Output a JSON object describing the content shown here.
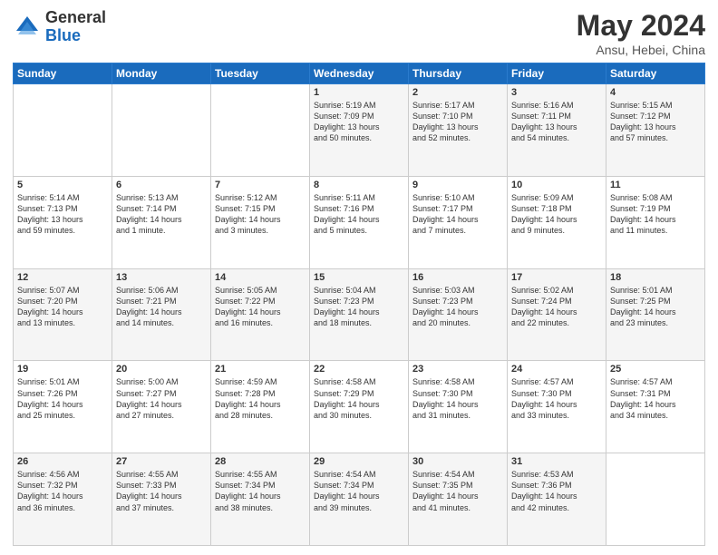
{
  "logo": {
    "general": "General",
    "blue": "Blue"
  },
  "title": {
    "month": "May 2024",
    "location": "Ansu, Hebei, China"
  },
  "weekdays": [
    "Sunday",
    "Monday",
    "Tuesday",
    "Wednesday",
    "Thursday",
    "Friday",
    "Saturday"
  ],
  "weeks": [
    [
      {
        "day": "",
        "info": ""
      },
      {
        "day": "",
        "info": ""
      },
      {
        "day": "",
        "info": ""
      },
      {
        "day": "1",
        "info": "Sunrise: 5:19 AM\nSunset: 7:09 PM\nDaylight: 13 hours\nand 50 minutes."
      },
      {
        "day": "2",
        "info": "Sunrise: 5:17 AM\nSunset: 7:10 PM\nDaylight: 13 hours\nand 52 minutes."
      },
      {
        "day": "3",
        "info": "Sunrise: 5:16 AM\nSunset: 7:11 PM\nDaylight: 13 hours\nand 54 minutes."
      },
      {
        "day": "4",
        "info": "Sunrise: 5:15 AM\nSunset: 7:12 PM\nDaylight: 13 hours\nand 57 minutes."
      }
    ],
    [
      {
        "day": "5",
        "info": "Sunrise: 5:14 AM\nSunset: 7:13 PM\nDaylight: 13 hours\nand 59 minutes."
      },
      {
        "day": "6",
        "info": "Sunrise: 5:13 AM\nSunset: 7:14 PM\nDaylight: 14 hours\nand 1 minute."
      },
      {
        "day": "7",
        "info": "Sunrise: 5:12 AM\nSunset: 7:15 PM\nDaylight: 14 hours\nand 3 minutes."
      },
      {
        "day": "8",
        "info": "Sunrise: 5:11 AM\nSunset: 7:16 PM\nDaylight: 14 hours\nand 5 minutes."
      },
      {
        "day": "9",
        "info": "Sunrise: 5:10 AM\nSunset: 7:17 PM\nDaylight: 14 hours\nand 7 minutes."
      },
      {
        "day": "10",
        "info": "Sunrise: 5:09 AM\nSunset: 7:18 PM\nDaylight: 14 hours\nand 9 minutes."
      },
      {
        "day": "11",
        "info": "Sunrise: 5:08 AM\nSunset: 7:19 PM\nDaylight: 14 hours\nand 11 minutes."
      }
    ],
    [
      {
        "day": "12",
        "info": "Sunrise: 5:07 AM\nSunset: 7:20 PM\nDaylight: 14 hours\nand 13 minutes."
      },
      {
        "day": "13",
        "info": "Sunrise: 5:06 AM\nSunset: 7:21 PM\nDaylight: 14 hours\nand 14 minutes."
      },
      {
        "day": "14",
        "info": "Sunrise: 5:05 AM\nSunset: 7:22 PM\nDaylight: 14 hours\nand 16 minutes."
      },
      {
        "day": "15",
        "info": "Sunrise: 5:04 AM\nSunset: 7:23 PM\nDaylight: 14 hours\nand 18 minutes."
      },
      {
        "day": "16",
        "info": "Sunrise: 5:03 AM\nSunset: 7:23 PM\nDaylight: 14 hours\nand 20 minutes."
      },
      {
        "day": "17",
        "info": "Sunrise: 5:02 AM\nSunset: 7:24 PM\nDaylight: 14 hours\nand 22 minutes."
      },
      {
        "day": "18",
        "info": "Sunrise: 5:01 AM\nSunset: 7:25 PM\nDaylight: 14 hours\nand 23 minutes."
      }
    ],
    [
      {
        "day": "19",
        "info": "Sunrise: 5:01 AM\nSunset: 7:26 PM\nDaylight: 14 hours\nand 25 minutes."
      },
      {
        "day": "20",
        "info": "Sunrise: 5:00 AM\nSunset: 7:27 PM\nDaylight: 14 hours\nand 27 minutes."
      },
      {
        "day": "21",
        "info": "Sunrise: 4:59 AM\nSunset: 7:28 PM\nDaylight: 14 hours\nand 28 minutes."
      },
      {
        "day": "22",
        "info": "Sunrise: 4:58 AM\nSunset: 7:29 PM\nDaylight: 14 hours\nand 30 minutes."
      },
      {
        "day": "23",
        "info": "Sunrise: 4:58 AM\nSunset: 7:30 PM\nDaylight: 14 hours\nand 31 minutes."
      },
      {
        "day": "24",
        "info": "Sunrise: 4:57 AM\nSunset: 7:30 PM\nDaylight: 14 hours\nand 33 minutes."
      },
      {
        "day": "25",
        "info": "Sunrise: 4:57 AM\nSunset: 7:31 PM\nDaylight: 14 hours\nand 34 minutes."
      }
    ],
    [
      {
        "day": "26",
        "info": "Sunrise: 4:56 AM\nSunset: 7:32 PM\nDaylight: 14 hours\nand 36 minutes."
      },
      {
        "day": "27",
        "info": "Sunrise: 4:55 AM\nSunset: 7:33 PM\nDaylight: 14 hours\nand 37 minutes."
      },
      {
        "day": "28",
        "info": "Sunrise: 4:55 AM\nSunset: 7:34 PM\nDaylight: 14 hours\nand 38 minutes."
      },
      {
        "day": "29",
        "info": "Sunrise: 4:54 AM\nSunset: 7:34 PM\nDaylight: 14 hours\nand 39 minutes."
      },
      {
        "day": "30",
        "info": "Sunrise: 4:54 AM\nSunset: 7:35 PM\nDaylight: 14 hours\nand 41 minutes."
      },
      {
        "day": "31",
        "info": "Sunrise: 4:53 AM\nSunset: 7:36 PM\nDaylight: 14 hours\nand 42 minutes."
      },
      {
        "day": "",
        "info": ""
      }
    ]
  ]
}
